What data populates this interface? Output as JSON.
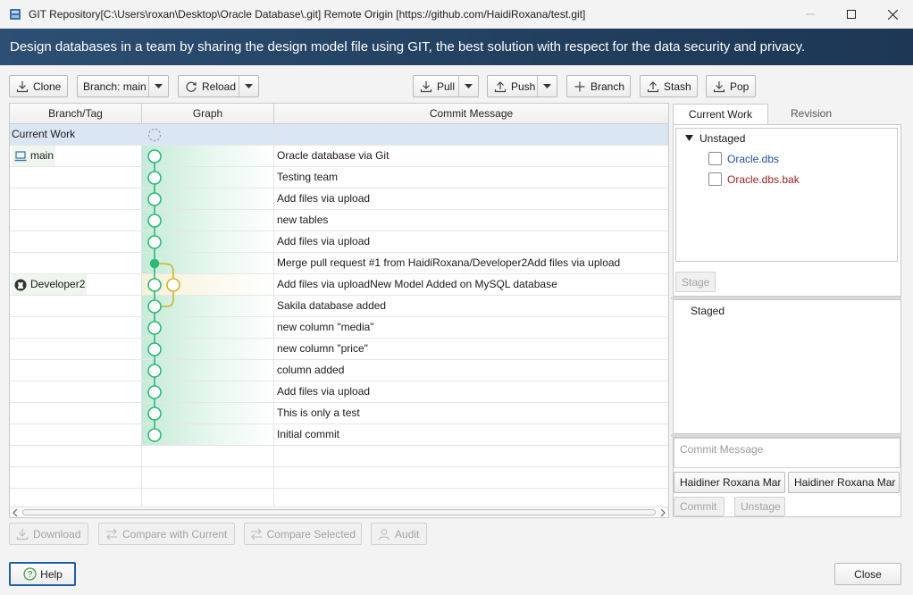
{
  "window": {
    "title": "GIT Repository[C:\\Users\\roxan\\Desktop\\Oracle Database\\.git] Remote Origin [https://github.com/HaidiRoxana/test.git]"
  },
  "banner": {
    "text": "Design databases in a team by sharing the design model file using GIT, the best solution with respect for the data security and privacy."
  },
  "toolbar": {
    "clone": "Clone",
    "branch": "Branch: main",
    "reload": "Reload",
    "pull": "Pull",
    "push": "Push",
    "new_branch": "Branch",
    "stash": "Stash",
    "pop": "Pop"
  },
  "table": {
    "headers": [
      "Branch/Tag",
      "Graph",
      "Commit Message"
    ],
    "rows": [
      {
        "branch": "Current Work",
        "message": ""
      },
      {
        "branch": "main",
        "message": "Oracle database via Git"
      },
      {
        "branch": "",
        "message": "Testing team"
      },
      {
        "branch": "",
        "message": "Add files via upload"
      },
      {
        "branch": "",
        "message": "new tables"
      },
      {
        "branch": "",
        "message": "Add files via upload"
      },
      {
        "branch": "",
        "message": "Merge pull request #1 from HaidiRoxana/Developer2Add files via upload"
      },
      {
        "branch": "Developer2",
        "message": "Add files via uploadNew Model Added on MySQL database"
      },
      {
        "branch": "",
        "message": "Sakila database added"
      },
      {
        "branch": "",
        "message": "new column \"media\""
      },
      {
        "branch": "",
        "message": "new column \"price\""
      },
      {
        "branch": "",
        "message": "column added"
      },
      {
        "branch": "",
        "message": "Add files via upload"
      },
      {
        "branch": "",
        "message": "This is only a test"
      },
      {
        "branch": "",
        "message": "Initial commit"
      }
    ]
  },
  "bottom_actions": {
    "download": "Download",
    "compare_current": "Compare with Current",
    "compare_selected": "Compare Selected",
    "audit": "Audit"
  },
  "side": {
    "tabs": [
      "Current Work",
      "Revision"
    ],
    "unstaged_label": "Unstaged",
    "files": [
      {
        "name": "Oracle.dbs",
        "color": "#1f4e99"
      },
      {
        "name": "Oracle.dbs.bak",
        "color": "#9b1c1c"
      }
    ],
    "stage": "Stage",
    "staged_label": "Staged",
    "commit_placeholder": "Commit Message",
    "author_name": "Haidiner Roxana Mar",
    "author_email": "Haidiner Roxana Mar",
    "commit": "Commit",
    "unstage": "Unstage"
  },
  "footer": {
    "help": "Help",
    "close": "Close"
  },
  "colors": {
    "banner": "#223f5e",
    "graph_main": "#2db87a",
    "graph_branch": "#d4b12a",
    "selection": "#dbe6f4"
  }
}
